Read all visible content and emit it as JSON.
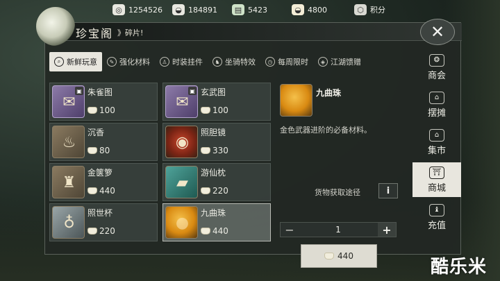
{
  "currencies": [
    {
      "icon": "film-reel-icon",
      "value": "1254526"
    },
    {
      "icon": "silver-ingot-icon",
      "value": "184891"
    },
    {
      "icon": "green-ticket-icon",
      "value": "5423"
    },
    {
      "icon": "gold-ingot-icon",
      "value": "4800"
    },
    {
      "icon": "points-badge-icon",
      "value": "积分"
    }
  ],
  "window": {
    "title": "珍宝阁",
    "breadcrumb": "》碎片!",
    "close_label": "✕"
  },
  "tabs": [
    {
      "label": "新鲜玩意",
      "icon": "magnifier-icon",
      "active": true
    },
    {
      "label": "强化材料",
      "icon": "feather-icon",
      "active": false
    },
    {
      "label": "时装挂件",
      "icon": "robe-icon",
      "active": false
    },
    {
      "label": "坐骑特效",
      "icon": "horse-icon",
      "active": false
    },
    {
      "label": "每周限时",
      "icon": "clock-icon",
      "active": false
    },
    {
      "label": "江湖馈赠",
      "icon": "gift-icon",
      "active": false
    }
  ],
  "items": [
    {
      "name": "朱雀图",
      "price": "100",
      "locked": true,
      "rare": true,
      "glyph": "✉"
    },
    {
      "name": "玄武图",
      "price": "100",
      "locked": true,
      "rare": true,
      "glyph": "✉"
    },
    {
      "name": "沉香",
      "price": "80",
      "locked": false,
      "rare": false,
      "glyph": "♨"
    },
    {
      "name": "照胆镜",
      "price": "330",
      "locked": false,
      "rare": false,
      "glyph": "◉"
    },
    {
      "name": "金箧箩",
      "price": "440",
      "locked": false,
      "rare": false,
      "glyph": "♜"
    },
    {
      "name": "游仙枕",
      "price": "220",
      "locked": false,
      "rare": false,
      "glyph": "▰"
    },
    {
      "name": "照世杯",
      "price": "220",
      "locked": false,
      "rare": false,
      "glyph": "♁"
    },
    {
      "name": "九曲珠",
      "price": "440",
      "locked": false,
      "rare": false,
      "glyph": "●",
      "selected": true
    }
  ],
  "detail": {
    "name": "九曲珠",
    "description": "金色武器进阶的必备材料。",
    "source_label": "货物获取途径",
    "info_label": "i",
    "quantity": "1",
    "minus_label": "−",
    "plus_label": "+",
    "buy_price": "440"
  },
  "side_nav": [
    {
      "label": "商会",
      "icon": "guild-emblem-icon",
      "active": false
    },
    {
      "label": "摆摊",
      "icon": "stall-icon",
      "active": false
    },
    {
      "label": "集市",
      "icon": "market-icon",
      "active": false
    },
    {
      "label": "商城",
      "icon": "pavilion-icon",
      "active": true
    },
    {
      "label": "充值",
      "icon": "money-bag-icon",
      "active": false
    }
  ],
  "watermark": "酷乐米"
}
